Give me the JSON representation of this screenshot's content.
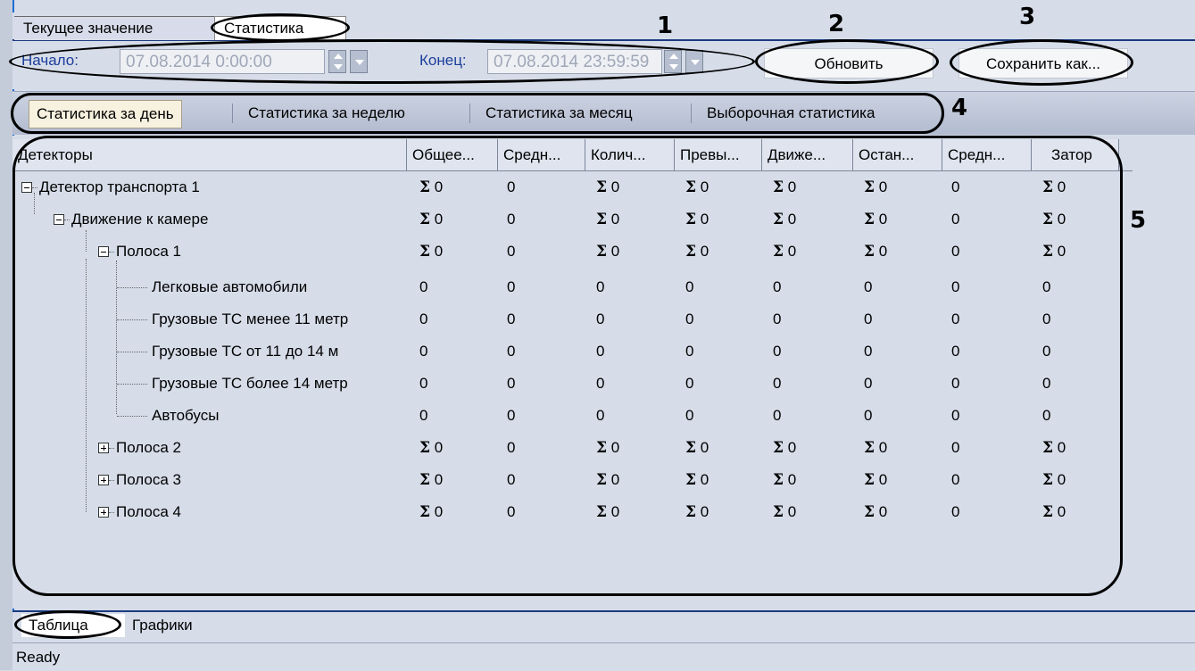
{
  "top_tabs": [
    "Текущее значение",
    "Статистика"
  ],
  "date": {
    "start_label": "Начало:",
    "start_value": "07.08.2014 0:00:00",
    "end_label": "Конец:",
    "end_value": "07.08.2014 23:59:59"
  },
  "buttons": {
    "refresh": "Обновить",
    "save_as": "Сохранить как..."
  },
  "period_tabs": [
    "Статистика за день",
    "Статистика за неделю",
    "Статистика за месяц",
    "Выборочная статистика"
  ],
  "columns": [
    "Детекторы",
    "Общее...",
    "Средн...",
    "Колич...",
    "Превы...",
    "Движе...",
    "Остан...",
    "Средн...",
    "Затор"
  ],
  "rows": [
    {
      "name": "Детектор транспорта 1",
      "values": [
        "Σ 0",
        "0",
        "Σ 0",
        "Σ 0",
        "Σ 0",
        "Σ 0",
        "0",
        "Σ 0"
      ]
    },
    {
      "name": "Движение к камере",
      "values": [
        "Σ 0",
        "0",
        "Σ 0",
        "Σ 0",
        "Σ 0",
        "Σ 0",
        "0",
        "Σ 0"
      ]
    },
    {
      "name": "Полоса 1",
      "values": [
        "Σ 0",
        "0",
        "Σ 0",
        "Σ 0",
        "Σ 0",
        "Σ 0",
        "0",
        "Σ 0"
      ]
    },
    {
      "name": "Легковые автомобили",
      "values": [
        "0",
        "0",
        "0",
        "0",
        "0",
        "0",
        "0",
        "0"
      ]
    },
    {
      "name": "Грузовые ТС менее 11 метр",
      "values": [
        "0",
        "0",
        "0",
        "0",
        "0",
        "0",
        "0",
        "0"
      ]
    },
    {
      "name": "Грузовые ТС от 11 до 14 м",
      "values": [
        "0",
        "0",
        "0",
        "0",
        "0",
        "0",
        "0",
        "0"
      ]
    },
    {
      "name": "Грузовые ТС более 14 метр",
      "values": [
        "0",
        "0",
        "0",
        "0",
        "0",
        "0",
        "0",
        "0"
      ]
    },
    {
      "name": "Автобусы",
      "values": [
        "0",
        "0",
        "0",
        "0",
        "0",
        "0",
        "0",
        "0"
      ]
    },
    {
      "name": "Полоса 2",
      "values": [
        "Σ 0",
        "0",
        "Σ 0",
        "Σ 0",
        "Σ 0",
        "Σ 0",
        "0",
        "Σ 0"
      ]
    },
    {
      "name": "Полоса 3",
      "values": [
        "Σ 0",
        "0",
        "Σ 0",
        "Σ 0",
        "Σ 0",
        "Σ 0",
        "0",
        "Σ 0"
      ]
    },
    {
      "name": "Полоса 4",
      "values": [
        "Σ 0",
        "0",
        "Σ 0",
        "Σ 0",
        "Σ 0",
        "Σ 0",
        "0",
        "Σ 0"
      ]
    }
  ],
  "bottom_tabs": [
    "Таблица",
    "Графики"
  ],
  "status": "Ready",
  "callouts": [
    "1",
    "2",
    "3",
    "4",
    "5"
  ]
}
